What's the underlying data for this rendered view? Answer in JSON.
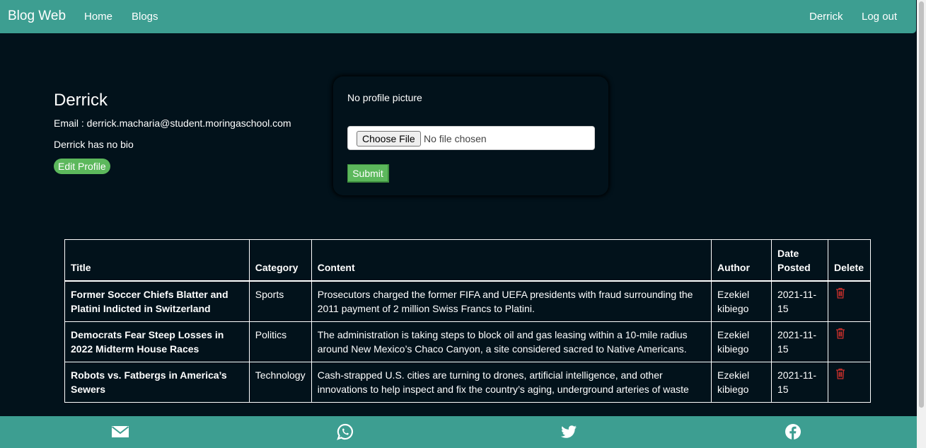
{
  "navbar": {
    "brand": "Blog Web",
    "links": [
      {
        "label": "Home"
      },
      {
        "label": "Blogs"
      }
    ],
    "user": "Derrick",
    "logout": "Log out"
  },
  "profile": {
    "name": "Derrick",
    "email_line": "Email : derrick.macharia@student.moringaschool.com",
    "bio": "Derrick has no bio",
    "edit_label": "Edit Profile"
  },
  "upload": {
    "no_picture_text": "No profile picture",
    "choose_file_label": "Choose File",
    "file_status": "No file chosen",
    "submit_label": "Submit"
  },
  "table": {
    "headers": [
      "Title",
      "Category",
      "Content",
      "Author",
      "Date Posted",
      "Delete"
    ],
    "rows": [
      {
        "title": "Former Soccer Chiefs Blatter and Platini Indicted in Switzerland",
        "category": "Sports",
        "content": "Prosecutors charged the former FIFA and UEFA presidents with fraud surrounding the 2011 payment of 2 million Swiss Francs to Platini.",
        "author": "Ezekiel kibiego",
        "date": "2021-11-15",
        "delete_icon": "trash-icon"
      },
      {
        "title": "Democrats Fear Steep Losses in 2022 Midterm House Races",
        "category": "Politics",
        "content": "The administration is taking steps to block oil and gas leasing within a 10-mile radius around New Mexico’s Chaco Canyon, a site considered sacred to Native Americans.",
        "author": "Ezekiel kibiego",
        "date": "2021-11-15",
        "delete_icon": "trash-icon"
      },
      {
        "title": "Robots vs. Fatbergs in America’s Sewers",
        "category": "Technology",
        "content": "Cash-strapped U.S. cities are turning to drones, artificial intelligence, and other innovations to help inspect and fix the country’s aging, underground arteries of waste",
        "author": "Ezekiel kibiego",
        "date": "2021-11-15",
        "delete_icon": "trash-icon"
      }
    ]
  },
  "footer": {
    "icons": [
      "email-icon",
      "whatsapp-icon",
      "twitter-icon",
      "facebook-icon"
    ]
  },
  "colors": {
    "navbar_bg": "#3d9e91",
    "page_bg": "#02121b",
    "button_green": "#5cb85c",
    "delete_red": "#c9302c"
  }
}
